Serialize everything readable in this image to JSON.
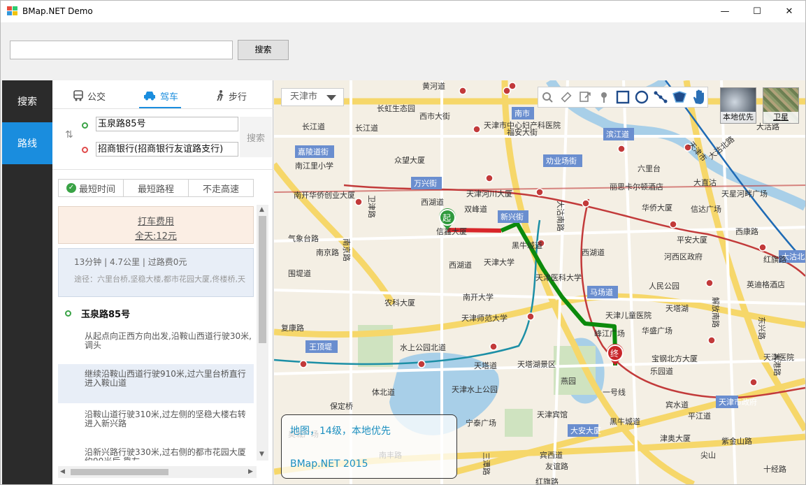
{
  "window": {
    "title": "BMap.NET Demo",
    "controls": [
      "—",
      "☐",
      "✕"
    ]
  },
  "toolbar": {
    "search_value": "",
    "search_button": "搜索"
  },
  "nav": {
    "items": [
      {
        "label": "搜索",
        "active": false
      },
      {
        "label": "路线",
        "active": true
      }
    ]
  },
  "route_panel": {
    "tabs": [
      {
        "label": "公交",
        "icon": "bus-icon"
      },
      {
        "label": "驾车",
        "icon": "car-icon",
        "active": true
      },
      {
        "label": "步行",
        "icon": "walk-icon"
      }
    ],
    "start": "玉泉路85号",
    "end": "招商银行(招商银行友谊路支行)",
    "search_button": "搜索",
    "policies": [
      "最短时间",
      "最短路程",
      "不走高速"
    ],
    "selected_policy": "最短时间",
    "taxi": {
      "title": "打车费用",
      "fare": "全天:12元"
    },
    "summary": {
      "line": "13分钟 | 4.7公里 | 过路费0元",
      "via": "途径：六里台桥,坚稳大楼,都市花园大厦,佟楼桥,天"
    },
    "start_label": "玉泉路85号",
    "steps": [
      "从起点向正西方向出发,沿鞍山西道行驶30米,调头",
      "继续沿鞍山西道行驶910米,过六里台桥直行进入鞍山道",
      "沿鞍山道行驶310米,过左侧的坚稳大楼右转进入新兴路",
      "沿新兴路行驶330米,过右侧的都市花园大厦约90米后,靠左"
    ]
  },
  "map": {
    "city": "天津市",
    "maptypes": [
      {
        "label": "本地优先"
      },
      {
        "label": "卫星"
      }
    ],
    "info_line1": "地图，14级，本地优先",
    "info_line2": "BMap.NET 2015",
    "markers": {
      "start": "起",
      "end": "终"
    },
    "colors": {
      "route_drive": "#0c8a0c",
      "route_jam": "#d8262a",
      "metro_red": "#c23a3a",
      "metro_blue": "#1f6bb5",
      "metro_teal": "#1c8fa6"
    },
    "labels": [
      "黄河道",
      "长虹生态园",
      "西市大街",
      "南市",
      "天津市中心妇产科医院",
      "福安大街",
      "滨江道",
      "长江道",
      "长江道",
      "嘉陵道街",
      "南江里小学",
      "众望大厦",
      "劝业场街",
      "天津河川大厦",
      "丽思卡尔顿酒店",
      "万兴街",
      "西湖道",
      "南开华侨创业大厦",
      "南丰路",
      "西湖道",
      "双峰道",
      "信鑫大厦",
      "新兴街",
      "华侨大厦",
      "信达广场",
      "天星河畔广场",
      "天津大学",
      "平安大厦",
      "河西区政府",
      "天津医科大学",
      "马场道",
      "人民公园",
      "英迪格酒店",
      "南开大学",
      "农科大厦",
      "天津儿童医院",
      "天津师范大学",
      "华盛广场",
      "峰江广场",
      "复康路",
      "宝钢北方大厦",
      "天津医院",
      "王顶堤",
      "水上公园北道",
      "天塔道",
      "天塔湖景区",
      "燕园",
      "乐园道",
      "天津水上公园",
      "宁泰广场",
      "天津宾馆",
      "平江道",
      "尖山",
      "宾水道",
      "天津市政府",
      "大安大厦",
      "黑牛城道",
      "津奥大厦",
      "紫金山路",
      "友谊路",
      "红旗路",
      "三潭路",
      "南京路",
      "卫津路",
      "围堤道",
      "大沽南路",
      "解放南路",
      "东兴路",
      "大港路",
      "大活路",
      "气象台路",
      "一号线",
      "宾西道",
      "黑牛城道",
      "南京路",
      "六里台",
      "西康路",
      "西湖道",
      "红旗路",
      "天津市",
      "大直沽",
      "体北道",
      "奥城广场",
      "天塔湖",
      "大沽北路",
      "十经路",
      "保定桥"
    ]
  }
}
